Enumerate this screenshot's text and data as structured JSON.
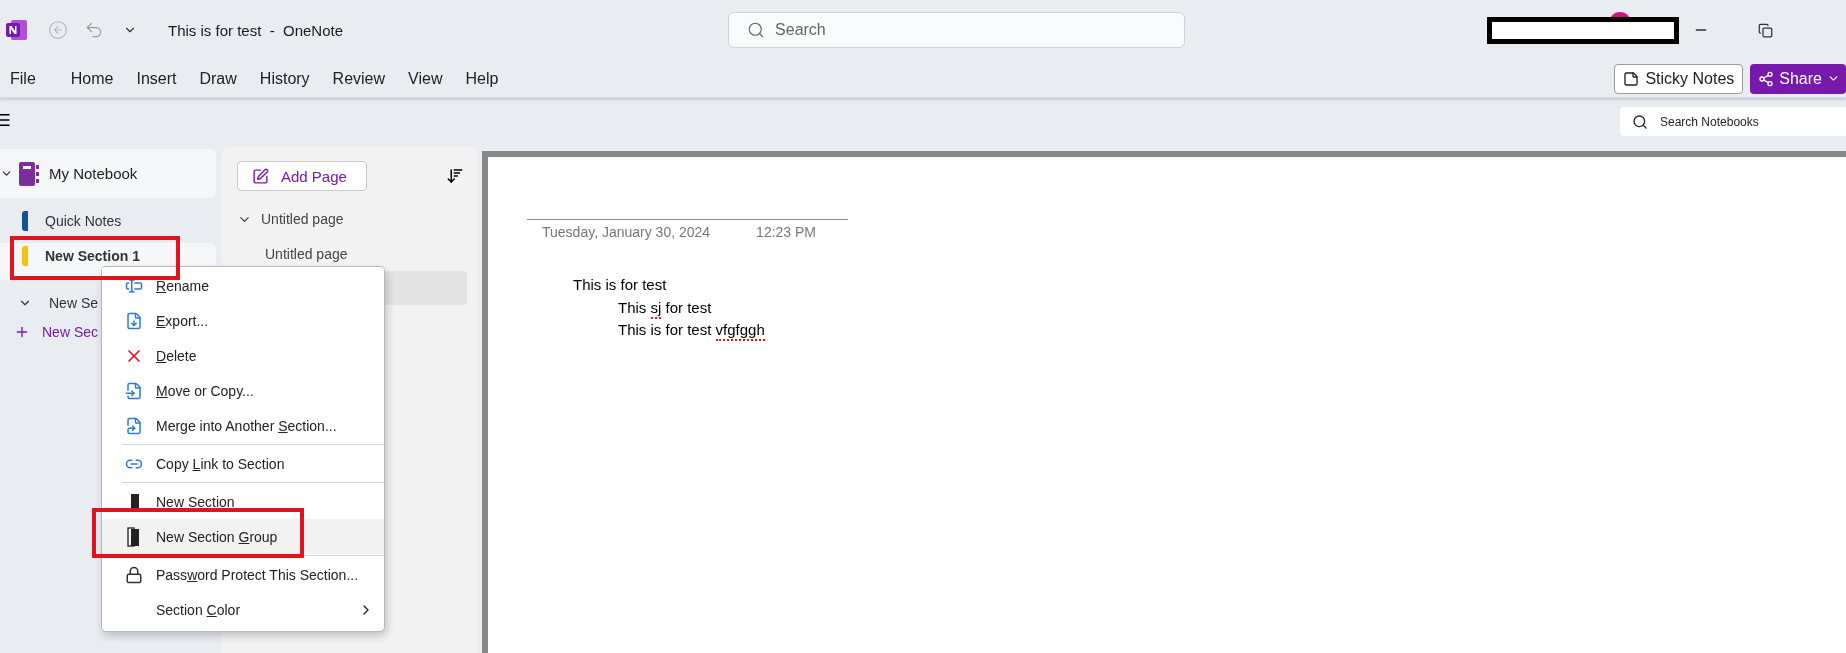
{
  "title_bar": {
    "title": "This is for test  -  OneNote",
    "search_placeholder": "Search"
  },
  "menu": [
    "File",
    "Home",
    "Insert",
    "Draw",
    "History",
    "Review",
    "View",
    "Help"
  ],
  "ribbon_buttons": [
    {
      "kind": "sticky",
      "label": "Sticky Notes"
    },
    {
      "kind": "share",
      "label": "Share"
    }
  ],
  "notebook_search": {
    "placeholder": "Search Notebooks"
  },
  "notebook": {
    "name": "My Notebook",
    "expanded": true,
    "sections": [
      {
        "kind": "section",
        "label": "Quick Notes",
        "color": "#0f5596",
        "selected": false,
        "highlighted": false
      },
      {
        "kind": "section",
        "label": "New Section 1",
        "color": "#f5c211",
        "selected": true,
        "highlighted": true
      },
      {
        "kind": "group",
        "label": "New Se",
        "expanded": true
      },
      {
        "kind": "add",
        "label": "New Sec"
      }
    ]
  },
  "pages": {
    "add_label": "Add Page",
    "items": [
      {
        "label": "Untitled page",
        "expanded": true,
        "selected": false,
        "children": [
          {
            "label": "Untitled page",
            "selected": false
          },
          {
            "selected": true
          }
        ]
      }
    ]
  },
  "note": {
    "date": "Tuesday, January 30, 2024",
    "time": "12:23 PM",
    "lines": [
      {
        "parts": [
          {
            "t": "This is for test",
            "misspelled": false
          }
        ],
        "children": [
          {
            "parts": [
              {
                "t": "This ",
                "misspelled": false
              },
              {
                "t": "sj",
                "misspelled": true
              },
              {
                "t": " for test",
                "misspelled": false
              }
            ]
          },
          {
            "parts": [
              {
                "t": "This is for test ",
                "misspelled": false
              },
              {
                "t": "vfgfggh",
                "misspelled": true
              }
            ]
          }
        ]
      }
    ]
  },
  "context_menu": {
    "groups": [
      [
        {
          "kind": "rename",
          "key": "R",
          "post": "ename",
          "hovered": false,
          "highlighted": false,
          "submenu": false
        },
        {
          "kind": "export",
          "key": "E",
          "post": "xport...",
          "hovered": false,
          "highlighted": false,
          "submenu": false
        },
        {
          "kind": "delete",
          "key": "D",
          "post": "elete",
          "hovered": false,
          "highlighted": false,
          "submenu": false
        },
        {
          "kind": "move",
          "key": "M",
          "post": "ove or Copy...",
          "hovered": false,
          "highlighted": false,
          "submenu": false
        },
        {
          "kind": "merge",
          "pre": "Merge into Another ",
          "key": "S",
          "post": "ection...",
          "hovered": false,
          "highlighted": false,
          "submenu": false
        }
      ],
      [
        {
          "kind": "link",
          "pre": "Copy ",
          "key": "L",
          "post": "ink to Section",
          "hovered": false,
          "highlighted": false,
          "submenu": false
        }
      ],
      [
        {
          "kind": "section",
          "pre": "New Sect",
          "key": "i",
          "post": "on",
          "hovered": false,
          "highlighted": false,
          "submenu": false
        },
        {
          "kind": "group",
          "pre": "New Section ",
          "key": "G",
          "post": "roup",
          "hovered": true,
          "highlighted": true,
          "submenu": false
        }
      ],
      [
        {
          "kind": "lock",
          "pre": "Pass",
          "key": "w",
          "post": "ord Protect This Section...",
          "hovered": false,
          "highlighted": false,
          "submenu": false
        },
        {
          "kind": "plain",
          "pre": "Section ",
          "key": "C",
          "post": "olor",
          "hovered": false,
          "highlighted": false,
          "submenu": true
        }
      ]
    ]
  }
}
